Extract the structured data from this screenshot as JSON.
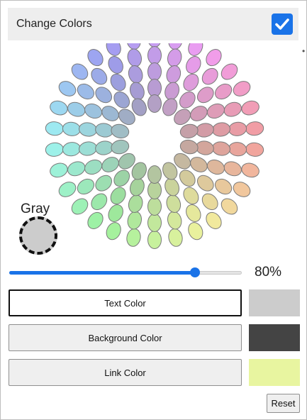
{
  "header": {
    "title": "Change Colors",
    "checked": true
  },
  "palette": {
    "gray_label": "Gray",
    "gray_color": "#cccccc",
    "dot_stroke": "#7a7a7a",
    "saturation_by_ring": [
      75,
      62,
      50,
      38,
      24
    ],
    "lightness_by_ring": [
      78,
      76,
      74,
      72,
      70
    ]
  },
  "slider": {
    "value_fraction": 0.8,
    "label": "80%"
  },
  "color_buttons": [
    {
      "label": "Text Color",
      "color": "#cccccc",
      "active": true
    },
    {
      "label": "Background Color",
      "color": "#444444",
      "active": false
    },
    {
      "label": "Link Color",
      "color": "#e8f5a0",
      "active": false
    }
  ],
  "reset_label": "Reset",
  "colors": {
    "accent": "#1a73e8",
    "header_bg": "#eeeeee"
  }
}
